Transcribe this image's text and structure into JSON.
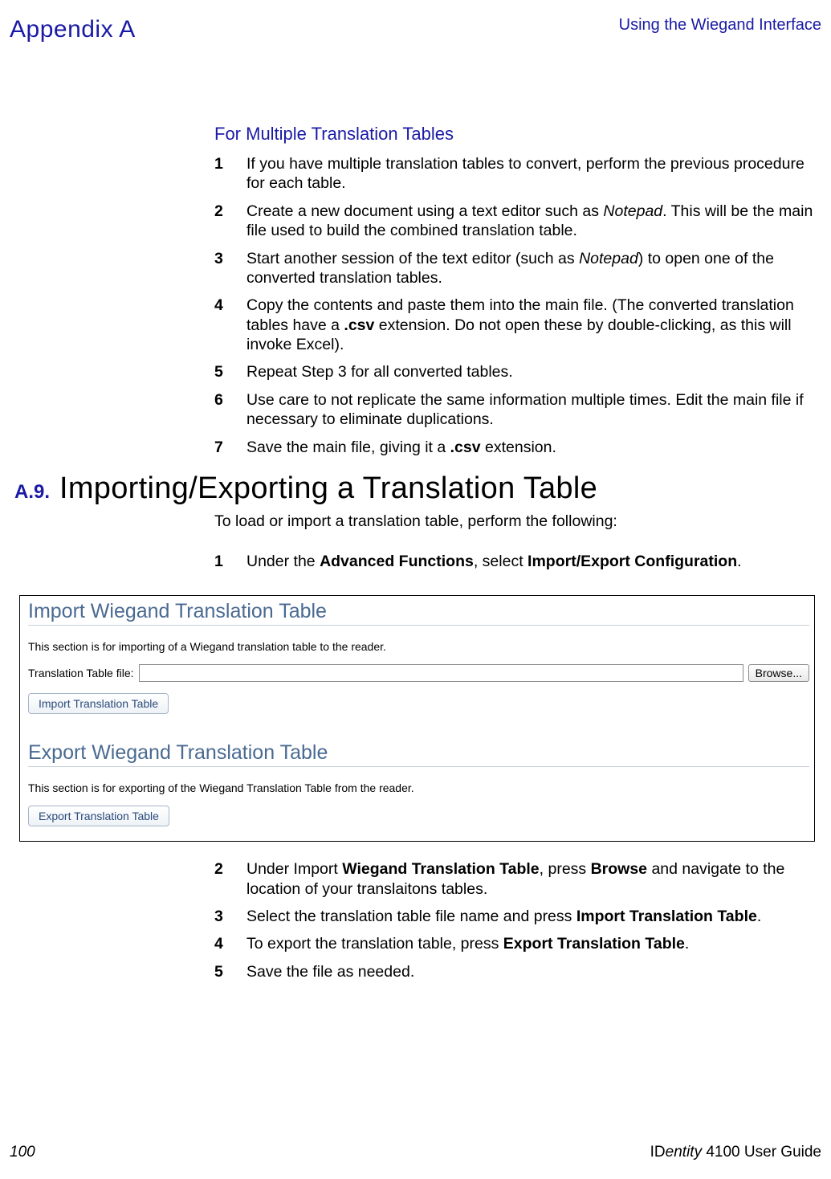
{
  "header": {
    "appendix": "Appendix A",
    "right": "Using the Wiegand Interface"
  },
  "section1": {
    "heading": "For Multiple Translation Tables",
    "items": [
      {
        "n": "1",
        "pre": "If you have multiple translation tables to convert, perform the previous procedure for each table."
      },
      {
        "n": "2",
        "a": "Create a new document using a text editor such as ",
        "em": "Notepad",
        "b": ". This will be the main file used to build the combined translation table."
      },
      {
        "n": "3",
        "a": "Start another session of the text editor (such as ",
        "em": "Notepad",
        "b": ") to open one of the converted translation tables."
      },
      {
        "n": "4",
        "a": "Copy the contents and paste them into the main file. (The converted translation tables have a ",
        "strong": ".csv",
        "b": " extension. Do not open these by double-clicking, as this will invoke Excel)."
      },
      {
        "n": "5",
        "pre": "Repeat Step 3 for all converted tables."
      },
      {
        "n": "6",
        "pre": "Use care to not replicate the same information multiple times. Edit the main file if necessary to eliminate duplications."
      },
      {
        "n": "7",
        "a": "Save the main file, giving it a ",
        "strong": ".csv",
        "b": " extension."
      }
    ]
  },
  "section2": {
    "num": "A.9.",
    "title": "Importing/Exporting a Translation Table",
    "intro": "To load or import a translation table, perform the following:",
    "step1": {
      "n": "1",
      "a": "Under the ",
      "s1": "Advanced Functions",
      "b": ", select ",
      "s2": "Import/Export Configuration",
      "c": "."
    }
  },
  "figure": {
    "h1": "Import Wiegand Translation Table",
    "d1": "This section is for importing of a Wiegand translation table to the reader.",
    "file_label": "Translation Table file:",
    "browse": "Browse...",
    "btn_import": "Import Translation Table",
    "h2": "Export Wiegand Translation Table",
    "d2": "This section is for exporting of the Wiegand Translation Table from the reader.",
    "btn_export": "Export Translation Table"
  },
  "section3": {
    "items": [
      {
        "n": "2",
        "a": "Under Import ",
        "s1": "Wiegand Translation Table",
        "b": ", press ",
        "s2": "Browse",
        "c": " and navigate to the location of your translaitons tables."
      },
      {
        "n": "3",
        "a": "Select the translation table file name and press ",
        "s1": "Import Translation Table",
        "b": "."
      },
      {
        "n": "4",
        "a": "To export the translation table, press ",
        "s1": "Export Translation Table",
        "b": "."
      },
      {
        "n": "5",
        "pre": "Save the file as needed."
      }
    ]
  },
  "footer": {
    "page": "100",
    "guide_prefix": "ID",
    "guide_em": "entity",
    "guide_suffix": " 4100 User Guide"
  }
}
